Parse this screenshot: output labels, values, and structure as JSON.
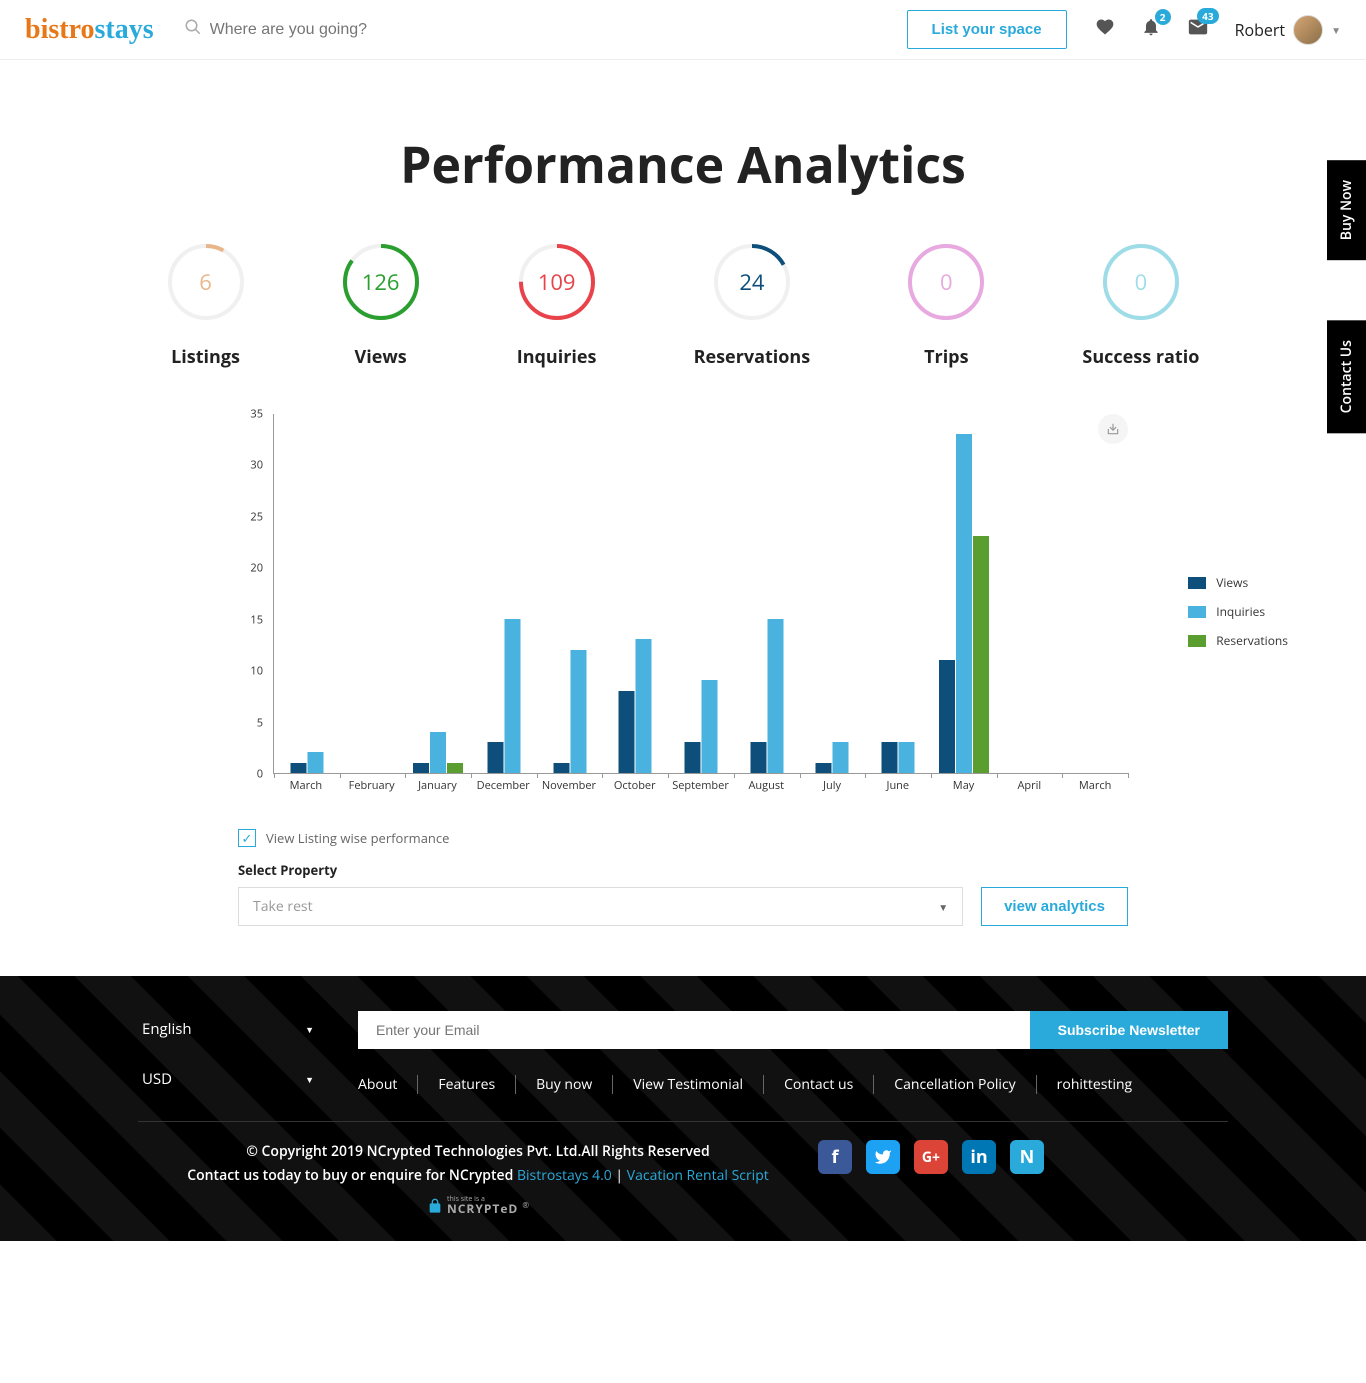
{
  "header": {
    "logo_part1": "bistro",
    "logo_part2": "stays",
    "search_placeholder": "Where are you going?",
    "list_space": "List your space",
    "notif_badge": "2",
    "msg_badge": "43",
    "username": "Robert"
  },
  "side_tabs": {
    "buy": "Buy Now",
    "contact": "Contact Us"
  },
  "page_title": "Performance Analytics",
  "stats": [
    {
      "value": "6",
      "label": "Listings",
      "color": "#e8b68a",
      "ratio": 0.08
    },
    {
      "value": "126",
      "label": "Views",
      "color": "#2a9e2f",
      "ratio": 0.85
    },
    {
      "value": "109",
      "label": "Inquiries",
      "color": "#e8434a",
      "ratio": 0.75
    },
    {
      "value": "24",
      "label": "Reservations",
      "color": "#0d4f7a",
      "ratio": 0.17
    },
    {
      "value": "0",
      "label": "Trips",
      "color": "#e8a8e0",
      "ratio": 1.0
    },
    {
      "value": "0",
      "label": "Success ratio",
      "color": "#9edde8",
      "ratio": 1.0
    }
  ],
  "chart_data": {
    "type": "bar",
    "categories": [
      "March",
      "February",
      "January",
      "December",
      "November",
      "October",
      "September",
      "August",
      "July",
      "June",
      "May",
      "April",
      "March"
    ],
    "series": [
      {
        "name": "Views",
        "values": [
          1,
          0,
          1,
          3,
          1,
          8,
          3,
          3,
          1,
          3,
          11,
          0,
          0
        ],
        "color": "#0d4f7a"
      },
      {
        "name": "Inquiries",
        "values": [
          2,
          0,
          4,
          15,
          12,
          13,
          9,
          15,
          3,
          3,
          33,
          0,
          0
        ],
        "color": "#49b2de"
      },
      {
        "name": "Reservations",
        "values": [
          0,
          0,
          1,
          0,
          0,
          0,
          0,
          0,
          0,
          0,
          23,
          0,
          0
        ],
        "color": "#5a9e2f"
      }
    ],
    "ylim": [
      0,
      35
    ],
    "yticks": [
      0,
      5,
      10,
      15,
      20,
      25,
      30,
      35
    ]
  },
  "controls": {
    "checkbox_label": "View Listing wise performance",
    "select_label": "Select Property",
    "select_value": "Take rest",
    "button": "view analytics"
  },
  "footer": {
    "lang": "English",
    "currency": "USD",
    "email_placeholder": "Enter your Email",
    "subscribe": "Subscribe Newsletter",
    "links": [
      "About",
      "Features",
      "Buy now",
      "View Testimonial",
      "Contact us",
      "Cancellation Policy",
      "rohittesting"
    ],
    "copyright": "© Copyright 2019 NCrypted Technologies Pvt. Ltd.All Rights Reserved",
    "contact_text": "Contact us today to buy or enquire for NCrypted ",
    "link1": "Bistrostays 4.0",
    "sep": " | ",
    "link2": "Vacation Rental Script",
    "ncrypted1": "this site is a",
    "ncrypted2": "NCRYPTeD"
  }
}
